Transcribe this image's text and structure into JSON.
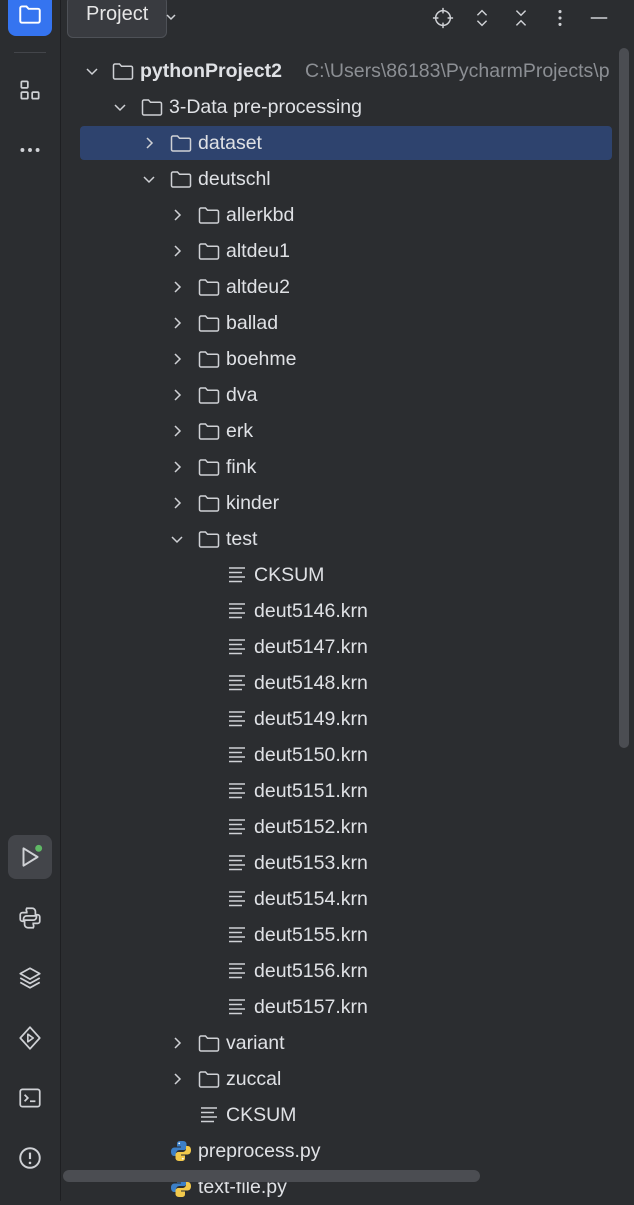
{
  "panel": {
    "title": "Project"
  },
  "left_strip": {
    "top_icons": [
      "project-folder-icon",
      "structure-icon",
      "more-icon"
    ],
    "bottom_icons": [
      "run-icon",
      "python-console-icon",
      "layers-icon",
      "services-icon",
      "terminal-icon",
      "problems-icon"
    ]
  },
  "header_icons": [
    "locate-icon",
    "expand-all-icon",
    "collapse-all-icon",
    "options-icon",
    "hide-icon"
  ],
  "tree": {
    "root": {
      "label": "pythonProject2",
      "path": "C:\\Users\\86183\\PycharmProjects\\p"
    },
    "data_folder": "3-Data pre-processing",
    "dataset": "dataset",
    "deutschl": "deutschl",
    "subfolders": [
      "allerkbd",
      "altdeu1",
      "altdeu2",
      "ballad",
      "boehme",
      "dva",
      "erk",
      "fink",
      "kinder"
    ],
    "test": "test",
    "test_files": [
      "CKSUM",
      "deut5146.krn",
      "deut5147.krn",
      "deut5148.krn",
      "deut5149.krn",
      "deut5150.krn",
      "deut5151.krn",
      "deut5152.krn",
      "deut5153.krn",
      "deut5154.krn",
      "deut5155.krn",
      "deut5156.krn",
      "deut5157.krn"
    ],
    "after_test": [
      "variant",
      "zuccal"
    ],
    "deutschl_file": "CKSUM",
    "py_files": [
      "preprocess.py",
      "text-file.py"
    ]
  },
  "colors": {
    "accent": "#3574f0",
    "selection": "#2e436e",
    "run_badge": "#5fb865"
  }
}
